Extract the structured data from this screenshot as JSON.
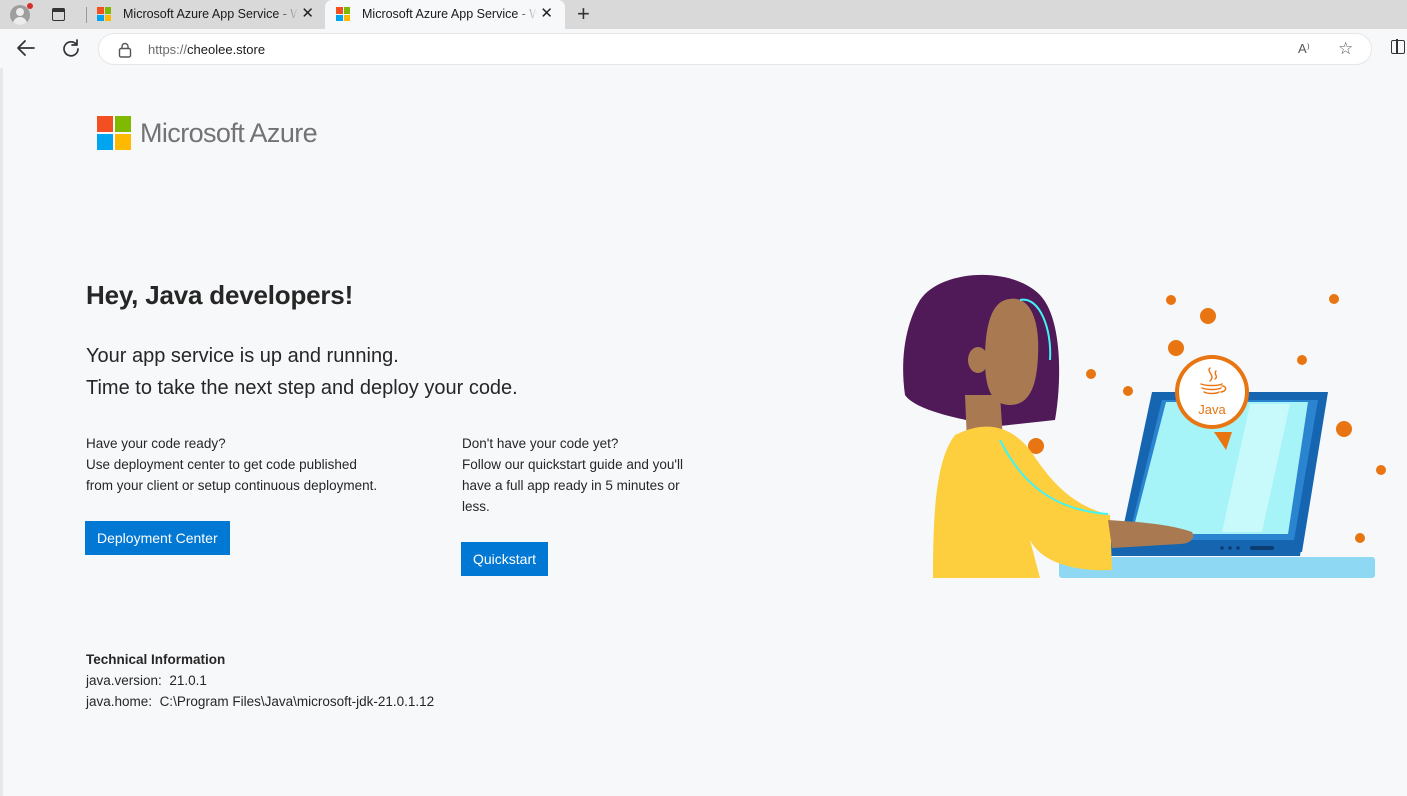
{
  "browser": {
    "tabs": [
      {
        "title": "Microsoft Azure App Service - Welcome",
        "active": false,
        "close": "✕"
      },
      {
        "title": "Microsoft Azure App Service - Welcome",
        "active": true,
        "close": "✕"
      }
    ],
    "new_tab": "+",
    "url_protocol": "https://",
    "url_host": "cheolee.store",
    "read_aloud": "A⁾",
    "favorite": "☆"
  },
  "logo": {
    "text": "Microsoft Azure"
  },
  "hero": {
    "title": "Hey, Java developers!",
    "subtitle_line1": "Your app service is up and running.",
    "subtitle_line2": "Time to take the next step and deploy your code."
  },
  "left_column": {
    "line1": "Have your code ready?",
    "line2": "Use deployment center to get code published",
    "line3": "from your client or setup continuous deployment.",
    "button": "Deployment Center"
  },
  "right_column": {
    "line1": "Don't have your code yet?",
    "line2": "Follow our quickstart guide and you'll",
    "line3": "have a full app ready in 5 minutes or",
    "line4": "less.",
    "button": "Quickstart"
  },
  "technical_info": {
    "heading": "Technical Information",
    "java_version_label": "java.version:",
    "java_version": "21.0.1",
    "java_home_label": "java.home:",
    "java_home": "C:\\Program Files\\Java\\microsoft-jdk-21.0.1.12"
  },
  "illustration": {
    "badge_text": "Java"
  },
  "colors": {
    "accent": "#0078d4",
    "orange": "#e87511",
    "hair": "#4f1a57",
    "shirt": "#fdce3e",
    "screen": "#a6f3f8"
  }
}
